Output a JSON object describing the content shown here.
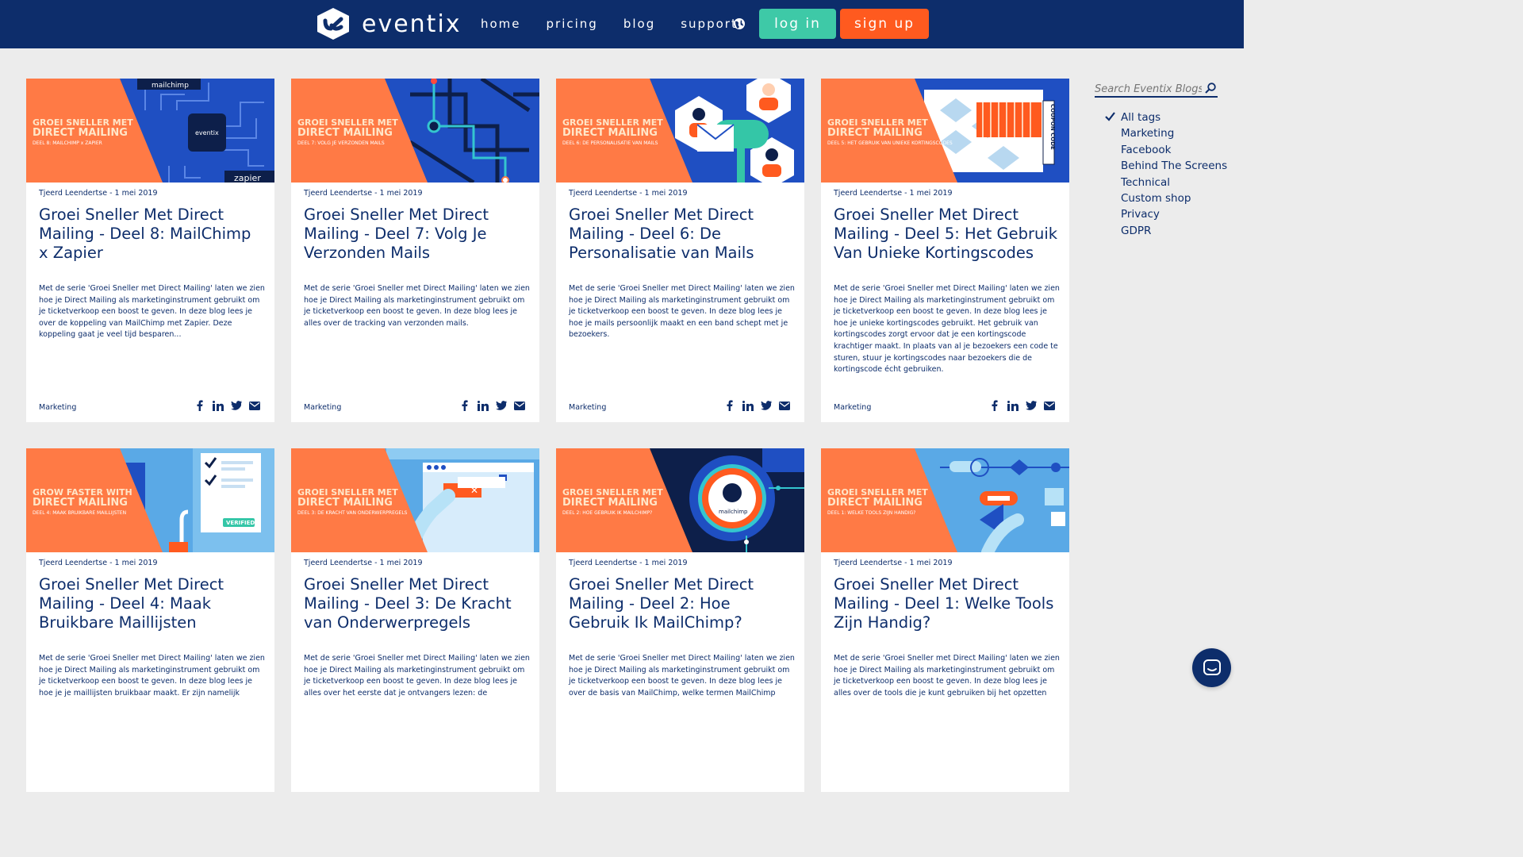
{
  "header": {
    "brand": "eventix",
    "nav": [
      "home",
      "pricing",
      "blog",
      "support"
    ],
    "login": "log in",
    "signup": "sign up"
  },
  "sidebar": {
    "search_placeholder": "Search Eventix Blogs",
    "tags": [
      "All tags",
      "Marketing",
      "Facebook",
      "Behind The Screens",
      "Technical",
      "Custom shop",
      "Privacy",
      "GDPR"
    ],
    "selected_tag": "All tags"
  },
  "posts": [
    {
      "img_l1": "GROEI SNELLER MET",
      "img_l2": "DIRECT MAILING",
      "img_l3": "DEEL 8: MAILCHIMP x ZAPIER",
      "img_brand_a": "mailchimp",
      "img_brand_b": "eventix",
      "img_brand_c": "zapier",
      "meta": "Tjeerd Leendertse - 1 mei 2019",
      "title": "Groei Sneller Met Direct Mailing - Deel 8: MailChimp x Zapier",
      "excerpt": "Met de serie 'Groei Sneller met Direct Mailing' laten we zien hoe je Direct Mailing als marketinginstrument gebruikt om je ticketverkoop een boost te geven. In deze blog lees je over de koppeling van MailChimp met Zapier. Deze koppeling gaat je veel tijd besparen...",
      "tag": "Marketing"
    },
    {
      "img_l1": "GROEI SNELLER MET",
      "img_l2": "DIRECT MAILING",
      "img_l3": "DEEL 7: VOLG JE VERZONDEN MAILS",
      "meta": "Tjeerd Leendertse - 1 mei 2019",
      "title": "Groei Sneller Met Direct Mailing - Deel 7: Volg Je Verzonden Mails",
      "excerpt": "Met de serie 'Groei Sneller met Direct Mailing' laten we zien hoe je Direct Mailing als marketinginstrument gebruikt om je ticketverkoop een boost te geven. In deze blog lees je alles over de tracking van verzonden mails.",
      "tag": "Marketing"
    },
    {
      "img_l1": "GROEI SNELLER MET",
      "img_l2": "DIRECT MAILING",
      "img_l3": "DEEL 6: DE PERSONALISATIE VAN MAILS",
      "meta": "Tjeerd Leendertse - 1 mei 2019",
      "title": "Groei Sneller Met Direct Mailing - Deel 6: De Personalisatie van Mails",
      "excerpt": "Met de serie 'Groei Sneller met Direct Mailing' laten we zien hoe je Direct Mailing als marketinginstrument gebruikt om je ticketverkoop een boost te geven. In deze blog lees je hoe je mails persoonlijk maakt en een band schept met je bezoekers.",
      "tag": "Marketing"
    },
    {
      "img_l1": "GROEI SNELLER MET",
      "img_l2": "DIRECT MAILING",
      "img_l3": "DEEL 5: HET GEBRUIK VAN UNIEKE KORTINGSCODES",
      "img_brand_a": "COUPON CODE",
      "meta": "Tjeerd Leendertse - 1 mei 2019",
      "title": "Groei Sneller Met Direct Mailing - Deel 5: Het Gebruik Van Unieke Kortingscodes",
      "excerpt": "Met de serie 'Groei Sneller met Direct Mailing' laten we zien hoe je Direct Mailing als marketinginstrument gebruikt om je ticketverkoop een boost te geven. In deze blog lees je hoe je unieke kortingscodes gebruikt. Het gebruik van kortingscodes zorgt ervoor dat je een kortingscode krachtiger maakt. In plaats van al je bezoekers een code te sturen, stuur je kortingscodes naar bezoekers die de kortingscode écht gebruiken.",
      "tag": "Marketing"
    },
    {
      "img_l1": "GROW FASTER WITH",
      "img_l2": "DIRECT MAILING",
      "img_l3": "DEEL 4: MAAK BRUIKBARE MAILLIJSTEN",
      "img_brand_a": "VERIFIED",
      "meta": "Tjeerd Leendertse - 1 mei 2019",
      "title": "Groei Sneller Met Direct Mailing - Deel 4: Maak Bruikbare Maillijsten",
      "excerpt": "Met de serie 'Groei Sneller met Direct Mailing' laten we zien hoe je Direct Mailing als marketinginstrument gebruikt om je ticketverkoop een boost te geven. In deze blog lees je hoe je je maillijsten bruikbaar maakt. Er zijn namelijk",
      "tag": "Marketing"
    },
    {
      "img_l1": "GROEI SNELLER MET",
      "img_l2": "DIRECT MAILING",
      "img_l3": "DEEL 3: DE KRACHT VAN ONDERWERPREGELS",
      "meta": "Tjeerd Leendertse - 1 mei 2019",
      "title": "Groei Sneller Met Direct Mailing - Deel 3: De Kracht van Onderwerpregels",
      "excerpt": "Met de serie 'Groei Sneller met Direct Mailing' laten we zien hoe je Direct Mailing als marketinginstrument gebruikt om je ticketverkoop een boost te geven. In deze blog lees je alles over het eerste dat je ontvangers lezen: de",
      "tag": "Marketing"
    },
    {
      "img_l1": "GROEI SNELLER MET",
      "img_l2": "DIRECT MAILING",
      "img_l3": "DEEL 2: HOE GEBRUIK IK MAILCHIMP?",
      "img_brand_a": "mailchimp",
      "meta": "Tjeerd Leendertse - 1 mei 2019",
      "title": "Groei Sneller Met Direct Mailing - Deel 2: Hoe Gebruik Ik MailChimp?",
      "excerpt": "Met de serie 'Groei Sneller met Direct Mailing' laten we zien hoe je Direct Mailing als marketinginstrument gebruikt om je ticketverkoop een boost te geven. In deze blog lees je over de basis van MailChimp, welke termen MailChimp",
      "tag": "Marketing"
    },
    {
      "img_l1": "GROEI SNELLER MET",
      "img_l2": "DIRECT MAILING",
      "img_l3": "DEEL 1: WELKE TOOLS ZIJN HANDIG?",
      "meta": "Tjeerd Leendertse - 1 mei 2019",
      "title": "Groei Sneller Met Direct Mailing - Deel 1: Welke Tools Zijn Handig?",
      "excerpt": "Met de serie 'Groei Sneller met Direct Mailing' laten we zien hoe je Direct Mailing als marketinginstrument gebruikt om je ticketverkoop een boost te geven. In deze blog lees je alles over de tools die je kunt gebruiken bij het opzetten",
      "tag": "Marketing"
    }
  ],
  "colors": {
    "navy": "#0d2d6b",
    "orange": "#ff7a45",
    "teal": "#3ec9a7",
    "signup": "#ff5a1f",
    "blue": "#1f4fc2"
  },
  "icons": [
    "facebook-icon",
    "linkedin-icon",
    "twitter-icon",
    "mail-icon",
    "globe-icon",
    "search-icon",
    "check-icon",
    "chat-icon"
  ]
}
